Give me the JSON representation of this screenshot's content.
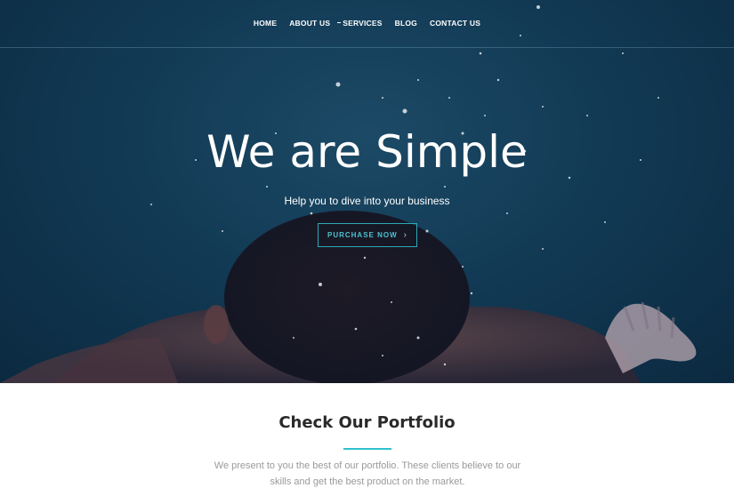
{
  "nav": {
    "items": [
      {
        "label": "HOME"
      },
      {
        "label": "ABOUT US"
      },
      {
        "label": "SERVICES"
      },
      {
        "label": "BLOG"
      },
      {
        "label": "CONTACT US"
      }
    ]
  },
  "hero": {
    "title": "We are Simple",
    "subtitle": "Help you to dive into your business",
    "cta_label": "PURCHASE NOW",
    "cta_icon": "chevron-right-icon"
  },
  "portfolio": {
    "title": "Check Our Portfolio",
    "description": "We present to you the best of our portfolio. These clients believe to our skills and get the best product on the market."
  },
  "colors": {
    "accent": "#2ec1d0",
    "hero_dark": "#0b2a40",
    "hero_mid": "#123a55",
    "text_dark": "#2a2a2a",
    "text_muted": "#9a9a9a"
  }
}
